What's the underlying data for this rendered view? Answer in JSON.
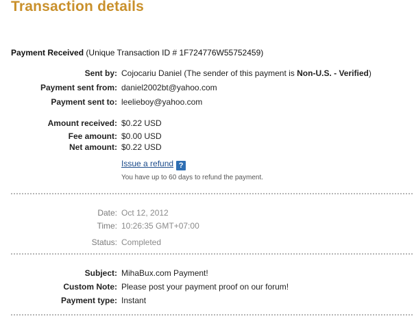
{
  "page": {
    "title": "Transaction details"
  },
  "header": {
    "status_label": "Payment Received",
    "transaction_id_text": "(Unique Transaction ID # 1F724776W55752459)"
  },
  "sender": {
    "sent_by_label": "Sent by:",
    "sent_by_name": "Cojocariu Daniel",
    "sender_note_prefix": "(The sender of this payment is ",
    "sender_note_status": "Non-U.S. - Verified",
    "sender_note_suffix": ")",
    "sent_from_label": "Payment sent from:",
    "sent_from_value": "daniel2002bt@yahoo.com",
    "sent_to_label": "Payment sent to:",
    "sent_to_value": "leelieboy@yahoo.com"
  },
  "amounts": {
    "received_label": "Amount received:",
    "received_value": "$0.22 USD",
    "fee_label": "Fee amount:",
    "fee_value": "$0.00 USD",
    "net_label": "Net amount:",
    "net_value": "$0.22 USD"
  },
  "refund": {
    "link_label": "Issue a refund",
    "help_icon_glyph": "?",
    "note": "You have up to 60 days to refund the payment."
  },
  "timing": {
    "date_label": "Date:",
    "date_value": "Oct 12, 2012",
    "time_label": "Time:",
    "time_value": "10:26:35 GMT+07:00",
    "status_label": "Status:",
    "status_value": "Completed"
  },
  "details": {
    "subject_label": "Subject:",
    "subject_value": "MihaBux.com Payment!",
    "note_label": "Custom Note:",
    "note_value": "Please post your payment proof on our forum!",
    "type_label": "Payment type:",
    "type_value": "Instant"
  },
  "colors": {
    "title": "#c9902b",
    "link": "#1a4a8a",
    "help_icon": "#2f6fb3"
  }
}
